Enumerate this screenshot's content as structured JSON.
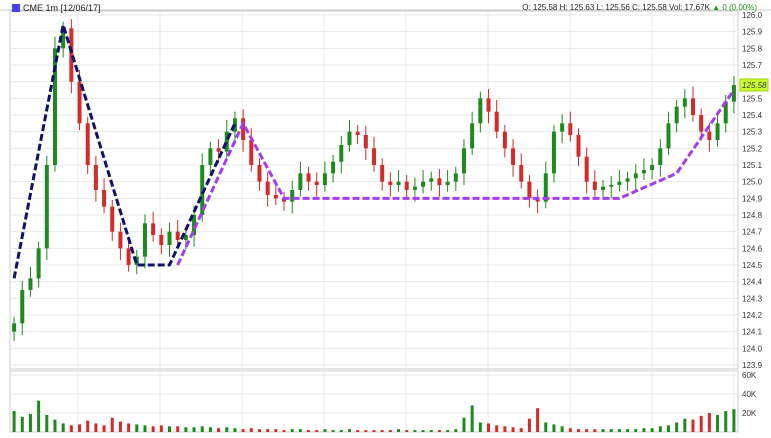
{
  "header": {
    "symbol": "CME 1m [12/06/17]",
    "ohlc": "O: 125.58 H: 125.63 L: 125.56 C: 125.58 Vol: 17.67K",
    "change_arrow": "▲",
    "change": "0 (0.00%)"
  },
  "colors": {
    "up": "#1e8a1e",
    "down": "#d42a2a",
    "pattern_black": "#101070",
    "pattern_purple": "#a43cf0",
    "last_price_bg": "#c8ff2e",
    "grid": "#e8e8e8"
  },
  "chart_data": [
    {
      "type": "line",
      "subtype": "candlestick",
      "title": "",
      "xlabel": "",
      "ylabel": "",
      "ylim": [
        123.9,
        126.0
      ],
      "yticks": [
        126.0,
        125.9,
        125.8,
        125.7,
        125.6,
        125.5,
        125.4,
        125.3,
        125.2,
        125.1,
        125.0,
        124.9,
        124.8,
        124.7,
        124.6,
        124.5,
        124.4,
        124.3,
        124.2,
        124.1,
        124.0,
        123.9
      ],
      "last_price_label": "125.58",
      "series": [
        {
          "values": [
            124.15,
            124.35,
            124.42,
            124.6,
            125.1,
            125.8,
            125.92,
            125.6,
            125.35,
            125.1,
            124.95,
            124.85,
            124.7,
            124.6,
            124.5,
            124.55,
            124.75,
            124.68,
            124.62,
            124.7,
            124.65,
            124.68,
            124.8,
            125.1,
            125.2,
            125.18,
            125.3,
            125.38,
            125.25,
            125.1,
            125.0,
            124.92,
            124.9,
            124.88,
            124.95,
            125.05,
            125.0,
            124.98,
            125.05,
            125.12,
            125.22,
            125.3,
            125.28,
            125.2,
            125.1,
            125.0,
            124.98,
            125.0,
            124.95,
            124.97,
            125.0,
            125.02,
            124.98,
            125.0,
            125.05,
            125.2,
            125.35,
            125.5,
            125.42,
            125.3,
            125.2,
            125.1,
            125.0,
            124.9,
            124.88,
            125.05,
            125.3,
            125.35,
            125.28,
            125.15,
            125.0,
            124.95,
            124.97,
            124.98,
            125.0,
            125.02,
            125.05,
            125.07,
            125.1,
            125.2,
            125.35,
            125.45,
            125.5,
            125.4,
            125.3,
            125.25,
            125.35,
            125.48,
            125.58
          ]
        }
      ],
      "annotations": [
        {
          "name": "head-and-shoulders-outline",
          "color": "black",
          "style": "dashed",
          "points": [
            [
              0,
              124.42
            ],
            [
              6,
              125.94
            ],
            [
              15,
              124.5
            ],
            [
              19,
              124.5
            ],
            [
              27,
              125.35
            ]
          ]
        },
        {
          "name": "cup-outline",
          "color": "purple",
          "style": "dashed",
          "points": [
            [
              20,
              124.5
            ],
            [
              28,
              125.35
            ],
            [
              33,
              124.9
            ],
            [
              67,
              124.9
            ],
            [
              74,
              124.9
            ],
            [
              81,
              125.05
            ],
            [
              88,
              125.55
            ]
          ]
        }
      ]
    },
    {
      "type": "bar",
      "name": "volume",
      "ylim": [
        0,
        60000
      ],
      "yticks": [
        "60K",
        "40K",
        "20K"
      ],
      "values": [
        22000,
        16000,
        19000,
        33000,
        18000,
        13000,
        9000,
        7000,
        8000,
        12000,
        9000,
        7000,
        15000,
        11000,
        9000,
        8000,
        7000,
        6000,
        7000,
        6000,
        6000,
        5000,
        5000,
        6000,
        5000,
        4000,
        5000,
        4000,
        3000,
        4000,
        3000,
        3000,
        3000,
        2000,
        3000,
        3000,
        2000,
        2000,
        3000,
        2000,
        2000,
        3000,
        2000,
        2000,
        2000,
        2000,
        2000,
        3000,
        2000,
        2000,
        2000,
        2000,
        2000,
        2000,
        3000,
        15000,
        28000,
        10000,
        9000,
        7000,
        6000,
        5000,
        4000,
        14000,
        25000,
        10000,
        8000,
        6000,
        4000,
        3000,
        3000,
        3000,
        3000,
        3000,
        3000,
        3000,
        3000,
        4000,
        4000,
        6000,
        7000,
        10000,
        14000,
        13000,
        17000,
        20000,
        18000,
        22000,
        24000
      ]
    }
  ]
}
